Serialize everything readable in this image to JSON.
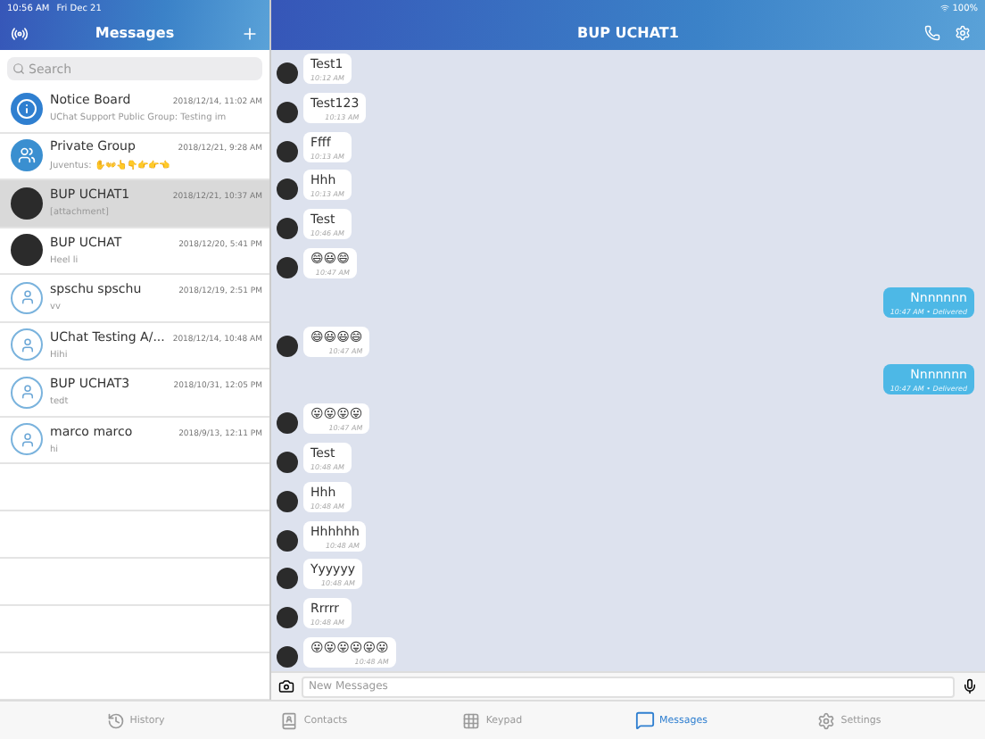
{
  "status_bar": {
    "time": "10:56 AM",
    "date": "Fri Dec 21",
    "battery": "100%"
  },
  "sidebar": {
    "title": "Messages",
    "search": {
      "placeholder": "Search"
    },
    "conversations": [
      {
        "name": "Notice Board",
        "time": "2018/12/14, 11:02 AM",
        "preview": "UChat Support Public Group: Testing im",
        "kind": "info",
        "selected": false
      },
      {
        "name": "Private Group",
        "time": "2018/12/21, 9:28 AM",
        "preview": "Juventus: ✋👐👆👇👉👉👈",
        "kind": "group",
        "selected": false
      },
      {
        "name": "BUP UCHAT1",
        "time": "2018/12/21, 10:37 AM",
        "preview": "[attachment]",
        "kind": "photo",
        "selected": true
      },
      {
        "name": "BUP UCHAT",
        "time": "2018/12/20, 5:41 PM",
        "preview": "Heel li",
        "kind": "photo",
        "selected": false
      },
      {
        "name": "spschu spschu",
        "time": "2018/12/19, 2:51 PM",
        "preview": "vv",
        "kind": "contact",
        "selected": false
      },
      {
        "name": "UChat Testing A/...",
        "time": "2018/12/14, 10:48 AM",
        "preview": "Hihi",
        "kind": "contact",
        "selected": false
      },
      {
        "name": "BUP UCHAT3",
        "time": "2018/10/31, 12:05 PM",
        "preview": "tedt",
        "kind": "contact",
        "selected": false
      },
      {
        "name": "marco marco",
        "time": "2018/9/13, 12:11 PM",
        "preview": "hi",
        "kind": "contact",
        "selected": false
      }
    ]
  },
  "chat": {
    "title": "BUP UCHAT1",
    "messages": [
      {
        "kind": "in",
        "text": "Test1",
        "time": "10:12 AM"
      },
      {
        "kind": "in",
        "text": "Test123",
        "time": "10:13 AM"
      },
      {
        "kind": "in",
        "text": "Ffff",
        "time": "10:13 AM"
      },
      {
        "kind": "in",
        "text": "Hhh",
        "time": "10:13 AM"
      },
      {
        "kind": "in",
        "text": "Test",
        "time": "10:46 AM"
      },
      {
        "kind": "in",
        "text": "😄😃😄",
        "time": "10:47 AM"
      },
      {
        "kind": "out",
        "text": "Nnnnnnn",
        "time": "10:47 AM • Delivered"
      },
      {
        "kind": "in",
        "text": "😄😃😃😄",
        "time": "10:47 AM"
      },
      {
        "kind": "out",
        "text": "Nnnnnnn",
        "time": "10:47 AM • Delivered"
      },
      {
        "kind": "in",
        "text": "😛😛😛😛",
        "time": "10:47 AM"
      },
      {
        "kind": "in",
        "text": "Test",
        "time": "10:48 AM"
      },
      {
        "kind": "in",
        "text": "Hhh",
        "time": "10:48 AM"
      },
      {
        "kind": "in",
        "text": "Hhhhhh",
        "time": "10:48 AM"
      },
      {
        "kind": "in",
        "text": "Yyyyyy",
        "time": "10:48 AM"
      },
      {
        "kind": "in",
        "text": "Rrrrr",
        "time": "10:48 AM"
      },
      {
        "kind": "in",
        "text": "😛😛😛😛😛😛",
        "time": "10:48 AM"
      }
    ],
    "input": {
      "placeholder": "New Messages"
    }
  },
  "tab_bar": [
    {
      "label": "History",
      "kind": "history",
      "selected": false
    },
    {
      "label": "Contacts",
      "kind": "contacts",
      "selected": false
    },
    {
      "label": "Keypad",
      "kind": "keypad",
      "selected": false
    },
    {
      "label": "Messages",
      "kind": "messages",
      "selected": true
    },
    {
      "label": "Settings",
      "kind": "settings",
      "selected": false
    }
  ]
}
